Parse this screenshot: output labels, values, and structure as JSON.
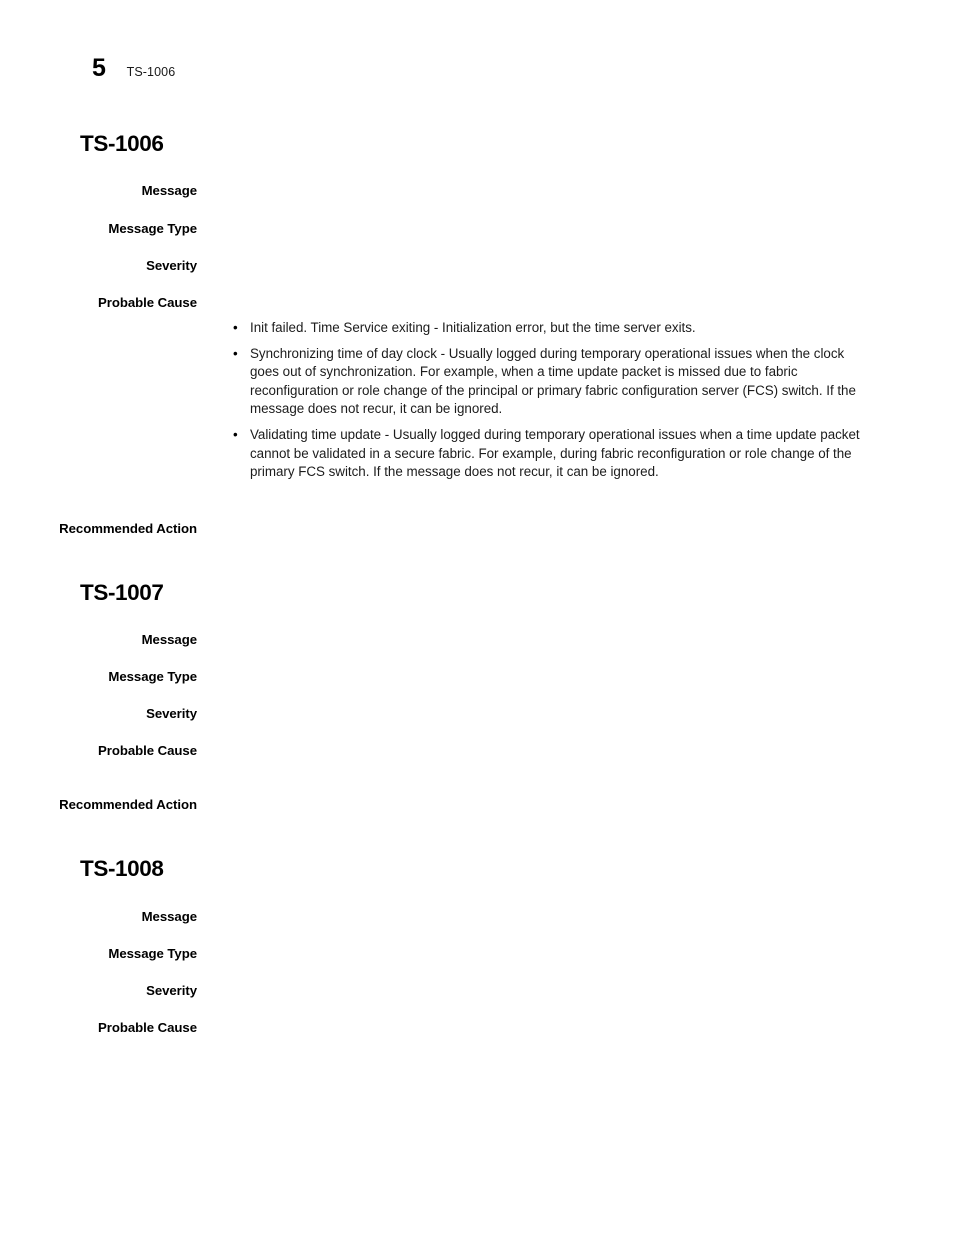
{
  "running_head": {
    "chapter_number": "5",
    "title": "TS-1006"
  },
  "sections": [
    {
      "heading": "TS-1006",
      "fields": [
        {
          "label": "Message"
        },
        {
          "label": "Message Type"
        },
        {
          "label": "Severity"
        },
        {
          "label": "Probable Cause"
        },
        {
          "label": "Recommended Action"
        }
      ],
      "probable_cause_bullets": [
        "Init failed. Time Service exiting - Initialization error, but the time server exits.",
        "Synchronizing time of day clock - Usually logged during temporary operational issues when the clock goes out of synchronization. For example, when a time update packet is missed due to fabric reconfiguration or role change of the principal or primary fabric configuration server (FCS) switch. If the message does not recur, it can be ignored.",
        "Validating time update - Usually logged during temporary operational issues when a time update packet cannot be validated in a secure fabric. For example, during fabric reconfiguration or role change of the primary FCS switch. If the message does not recur, it can be ignored."
      ]
    },
    {
      "heading": "TS-1007",
      "fields": [
        {
          "label": "Message"
        },
        {
          "label": "Message Type"
        },
        {
          "label": "Severity"
        },
        {
          "label": "Probable Cause"
        },
        {
          "label": "Recommended Action"
        }
      ]
    },
    {
      "heading": "TS-1008",
      "fields": [
        {
          "label": "Message"
        },
        {
          "label": "Message Type"
        },
        {
          "label": "Severity"
        },
        {
          "label": "Probable Cause"
        }
      ]
    }
  ],
  "bullet_marker": "•"
}
